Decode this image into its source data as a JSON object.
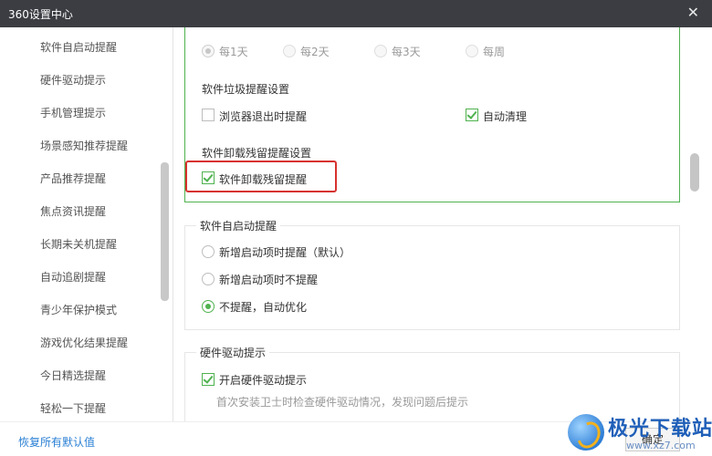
{
  "window": {
    "title": "360设置中心",
    "close_glyph": "✕"
  },
  "sidebar": {
    "items": [
      "软件自启动提醒",
      "硬件驱动提示",
      "手机管理提示",
      "场景感知推荐提醒",
      "产品推荐提醒",
      "焦点资讯提醒",
      "长期未关机提醒",
      "自动追剧提醒",
      "青少年保护模式",
      "游戏优化结果提醒",
      "今日精选提醒",
      "轻松一下提醒"
    ]
  },
  "freq": {
    "options": [
      "每1天",
      "每2天",
      "每3天",
      "每周"
    ],
    "selected": 0,
    "disabled": true
  },
  "junk": {
    "heading": "软件垃圾提醒设置",
    "browser_exit": {
      "label": "浏览器退出时提醒",
      "checked": false
    },
    "auto_clean": {
      "label": "自动清理",
      "checked": true
    }
  },
  "uninstall": {
    "heading": "软件卸载残留提醒设置",
    "residue": {
      "label": "软件卸载残留提醒",
      "checked": true
    }
  },
  "autostart": {
    "legend": "软件自启动提醒",
    "options": [
      "新增启动项时提醒（默认）",
      "新增启动项时不提醒",
      "不提醒，自动优化"
    ],
    "selected": 2
  },
  "driver": {
    "legend": "硬件驱动提示",
    "enable": {
      "label": "开启硬件驱动提示",
      "checked": true
    },
    "hint": "首次安装卫士时检查硬件驱动情况，发现问题后提示"
  },
  "footer": {
    "restore_label": "恢复所有默认值",
    "ok_label": "确定"
  },
  "watermark": {
    "text": "极光下载站",
    "url": "www.xz7.com"
  },
  "colors": {
    "accent": "#4fb24f",
    "highlight": "#d6322f",
    "link": "#2a7fd4",
    "titlebar": "#3b3d42"
  }
}
